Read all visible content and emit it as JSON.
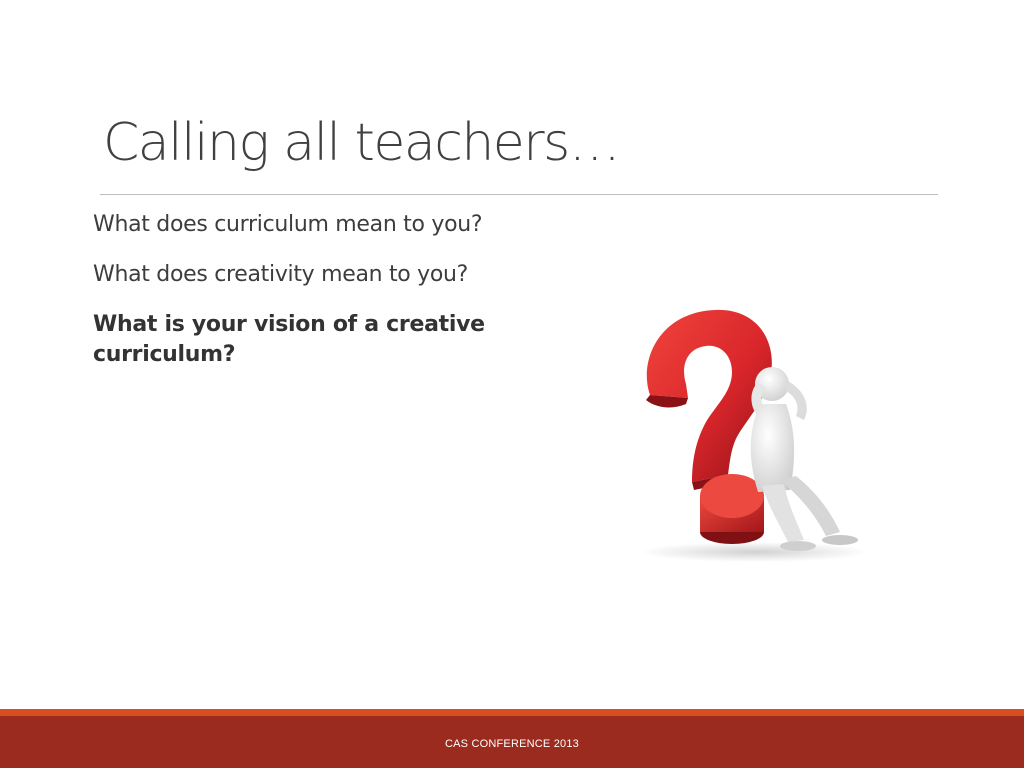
{
  "slide": {
    "title": "Calling all teachers…",
    "bullets": [
      {
        "text": "What does curriculum mean to you?",
        "bold": false
      },
      {
        "text": "What does creativity mean to you?",
        "bold": false
      },
      {
        "text": "What is your vision of a creative curriculum?",
        "bold": true
      }
    ],
    "illustration_icon": "question-mark-with-person-icon",
    "footer_text": "CAS CONFERENCE 2013"
  },
  "colors": {
    "footer_bar": "#9b2b1e",
    "footer_stripe": "#d94e1f",
    "question_mark_red": "#d9262b",
    "title_text": "#404040"
  }
}
